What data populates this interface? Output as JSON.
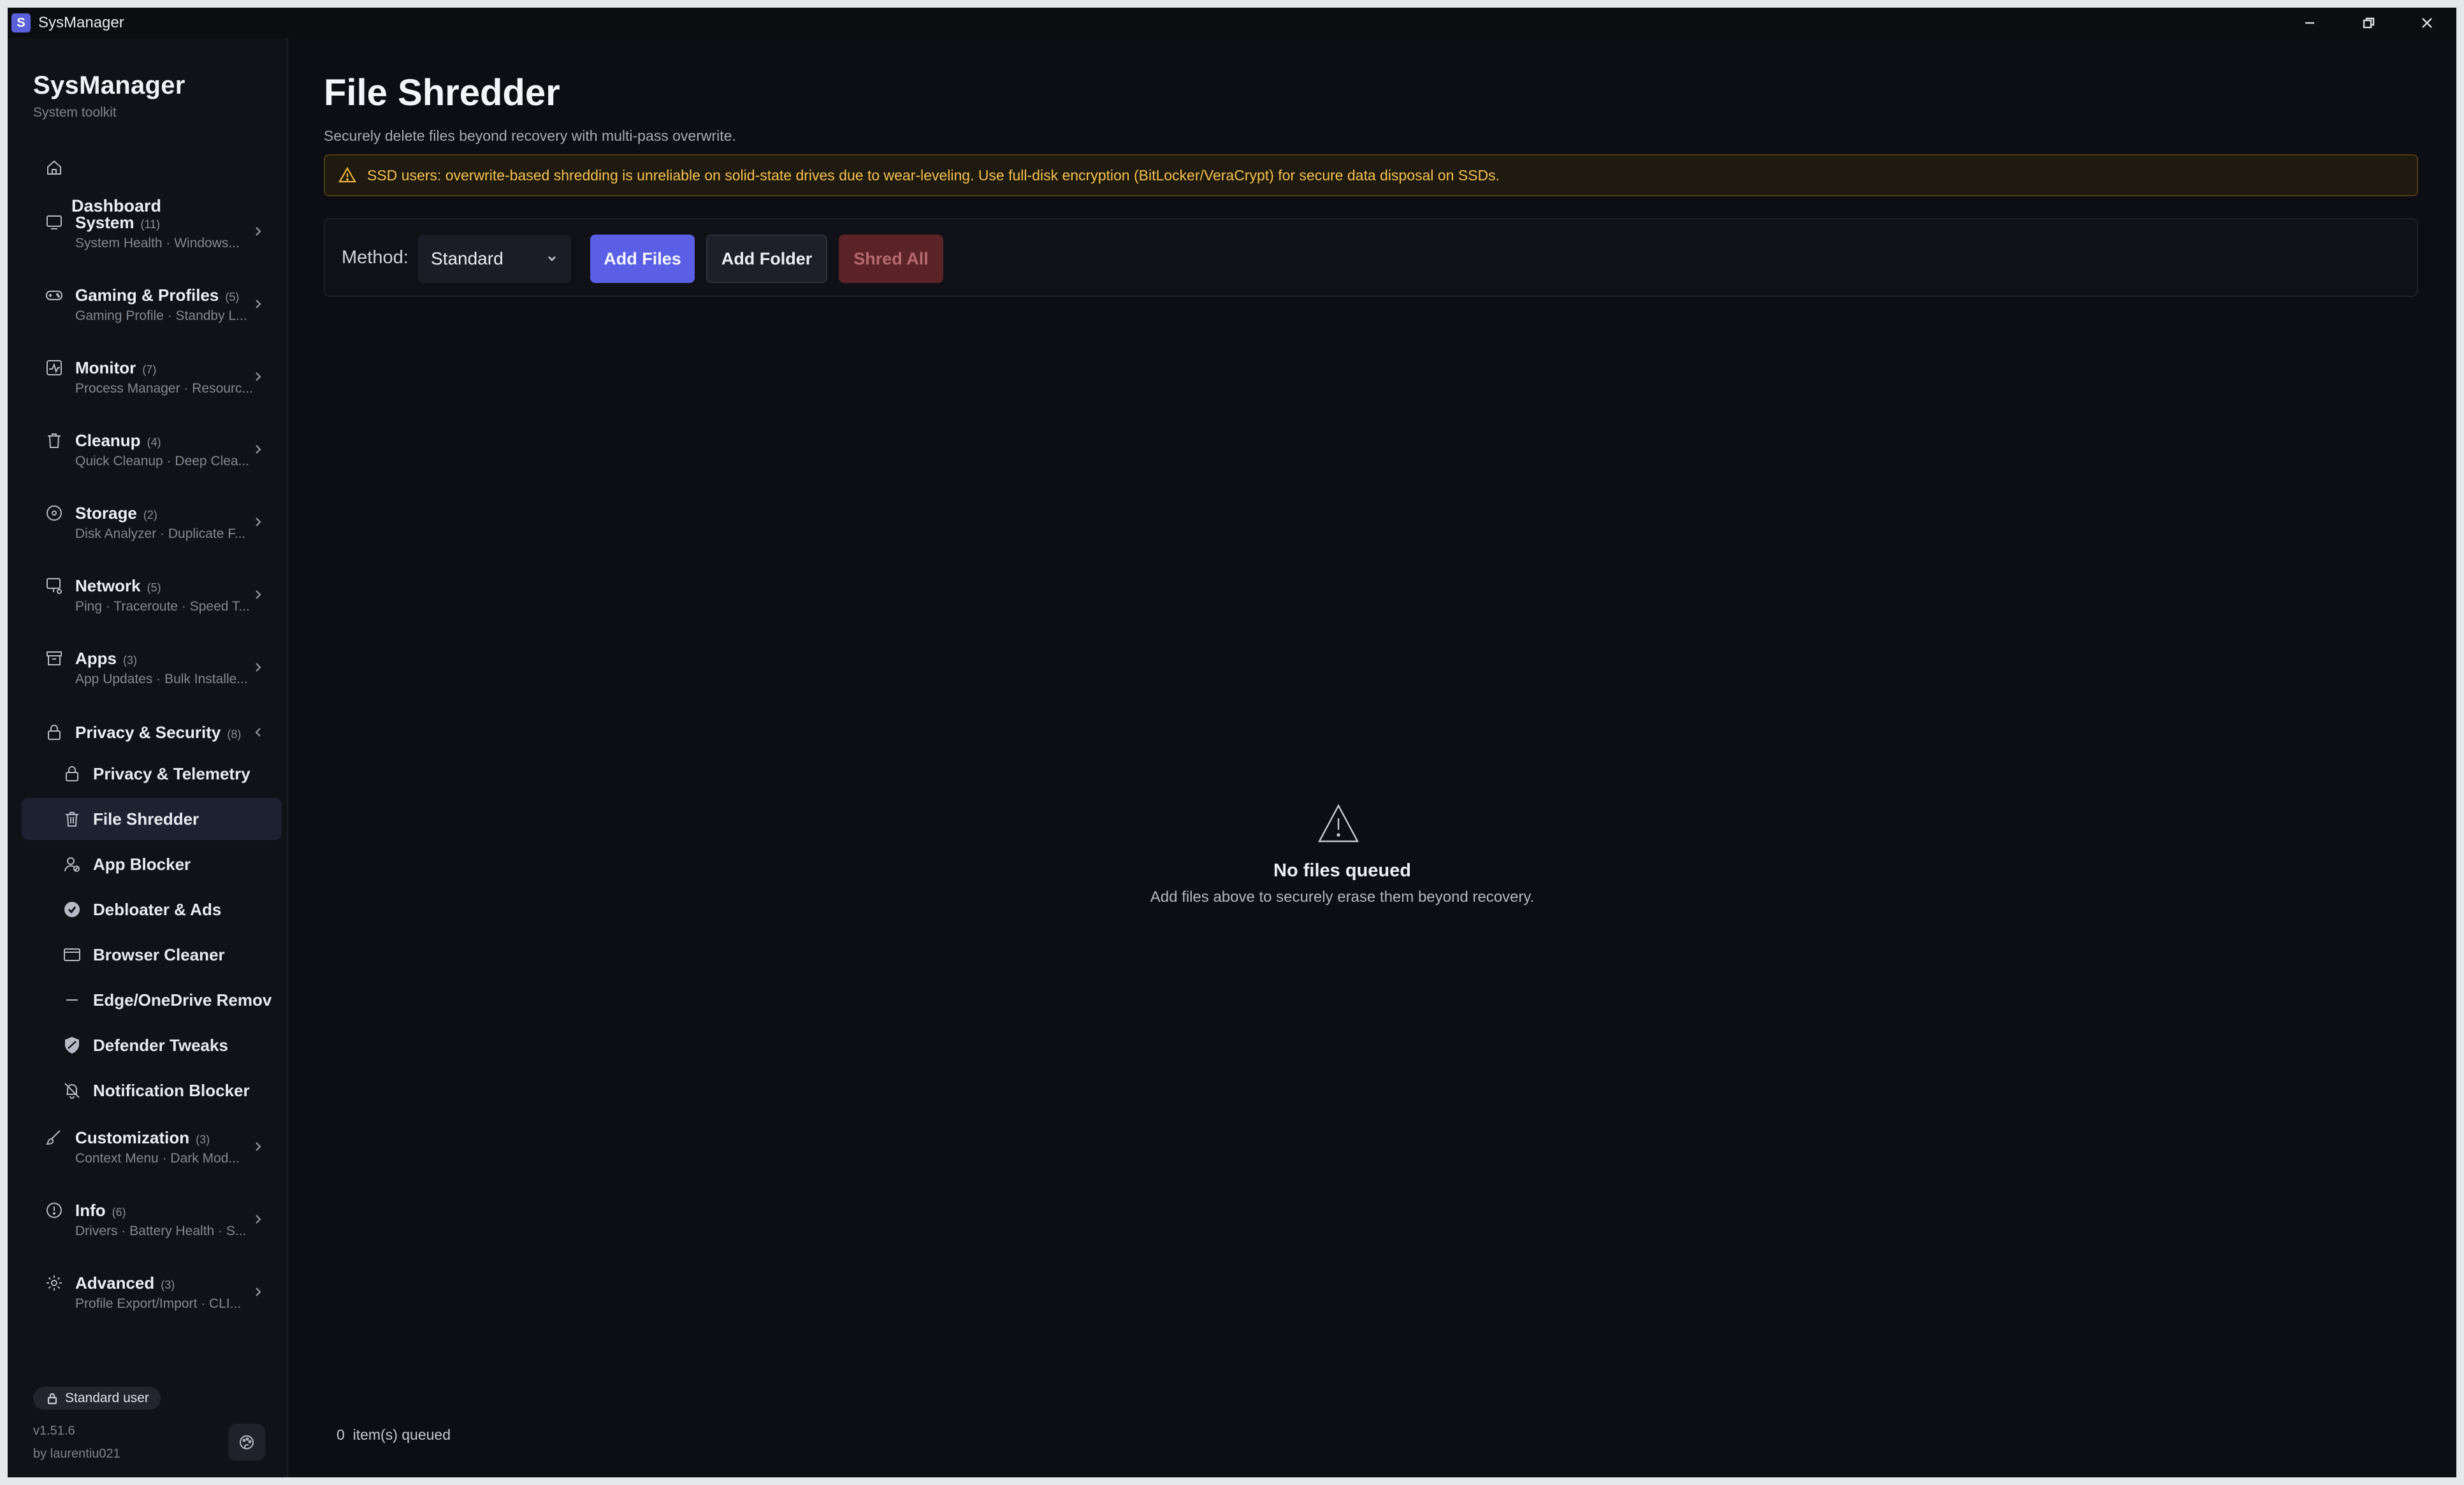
{
  "window": {
    "app_icon_letter": "S",
    "title": "SysManager"
  },
  "sidebar": {
    "brand_title": "SysManager",
    "brand_subtitle": "System toolkit",
    "dashboard_label": "Dashboard",
    "groups": [
      {
        "label": "System",
        "count": "(11)",
        "sub": "System Health · Windows..."
      },
      {
        "label": "Gaming & Profiles",
        "count": "(5)",
        "sub": "Gaming Profile · Standby L..."
      },
      {
        "label": "Monitor",
        "count": "(7)",
        "sub": "Process Manager · Resourc..."
      },
      {
        "label": "Cleanup",
        "count": "(4)",
        "sub": "Quick Cleanup · Deep Clea..."
      },
      {
        "label": "Storage",
        "count": "(2)",
        "sub": "Disk Analyzer · Duplicate F..."
      },
      {
        "label": "Network",
        "count": "(5)",
        "sub": "Ping · Traceroute · Speed T..."
      },
      {
        "label": "Apps",
        "count": "(3)",
        "sub": "App Updates · Bulk Installe..."
      },
      {
        "label": "Privacy & Security",
        "count": "(8)",
        "sub": ""
      },
      {
        "label": "Customization",
        "count": "(3)",
        "sub": "Context Menu · Dark Mod..."
      },
      {
        "label": "Info",
        "count": "(6)",
        "sub": "Drivers · Battery Health · S..."
      },
      {
        "label": "Advanced",
        "count": "(3)",
        "sub": "Profile Export/Import · CLI..."
      }
    ],
    "privacy_items": [
      {
        "label": "Privacy & Telemetry",
        "icon": "lock-icon"
      },
      {
        "label": "File Shredder",
        "icon": "trash-icon",
        "active": true
      },
      {
        "label": "App Blocker",
        "icon": "user-block-icon"
      },
      {
        "label": "Debloater & Ads",
        "icon": "check-circle-icon"
      },
      {
        "label": "Browser Cleaner",
        "icon": "browser-icon"
      },
      {
        "label": "Edge/OneDrive Remov",
        "icon": "minus-icon"
      },
      {
        "label": "Defender Tweaks",
        "icon": "shield-icon"
      },
      {
        "label": "Notification Blocker",
        "icon": "bell-off-icon"
      }
    ],
    "user_badge": "Standard user",
    "version": "v1.51.6",
    "author": "by laurentiu021"
  },
  "main": {
    "title": "File Shredder",
    "subtitle": "Securely delete files beyond recovery with multi-pass overwrite.",
    "warning": "SSD users: overwrite-based shredding is unreliable on solid-state drives due to wear-leveling. Use full-disk encryption (BitLocker/VeraCrypt) for secure data disposal on SSDs.",
    "method_label": "Method:",
    "method_value": "Standard",
    "add_files": "Add Files",
    "add_folder": "Add Folder",
    "shred_all": "Shred All",
    "empty_title": "No files queued",
    "empty_sub": "Add files above to securely erase them beyond recovery.",
    "queued_count": "0",
    "queued_label": "item(s) queued"
  },
  "colors": {
    "accent": "#5b5fe6",
    "danger_disabled": "#5b2227",
    "warning_text": "#f3c24e",
    "background": "#0c0e13",
    "sidebar": "#101217"
  }
}
